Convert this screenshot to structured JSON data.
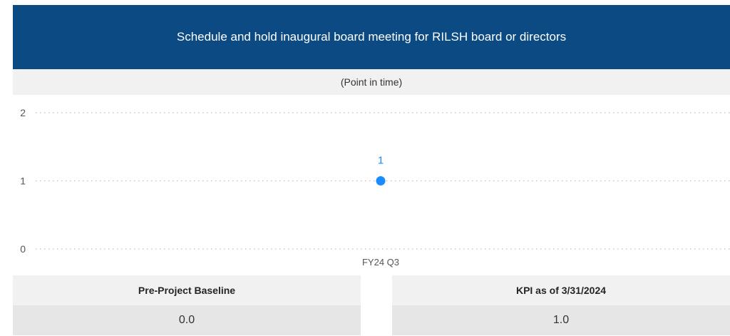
{
  "header": {
    "title": "Schedule and hold inaugural board meeting for RILSH board or directors",
    "subtitle": "(Point in time)"
  },
  "colors": {
    "banner": "#0b4a82",
    "point": "#1a8cff",
    "grid": "#bfbfbf"
  },
  "chart_data": {
    "type": "scatter",
    "x": [
      "FY24 Q3"
    ],
    "y_ticks": [
      0,
      1,
      2
    ],
    "ylim": [
      0,
      2
    ],
    "values": [
      1
    ],
    "data_labels": [
      "1"
    ],
    "grid": true
  },
  "kpis": {
    "baseline_label": "Pre-Project Baseline",
    "baseline_value": "0.0",
    "current_label": "KPI as of 3/31/2024",
    "current_value": "1.0"
  }
}
